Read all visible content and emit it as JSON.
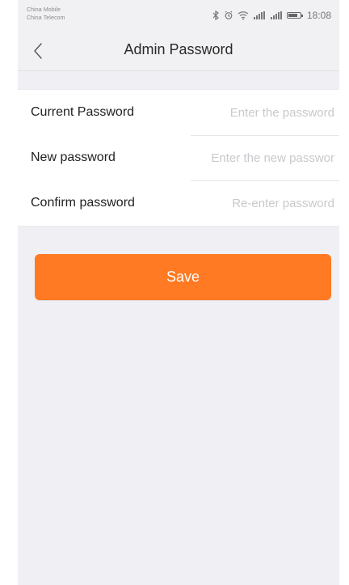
{
  "status_bar": {
    "carrier_1": "China Mobile",
    "carrier_2": "China Telecom",
    "time": "18:08",
    "icons": [
      "bluetooth-icon",
      "alarm-icon",
      "wifi-icon",
      "signal-icon",
      "signal-icon",
      "battery-icon"
    ],
    "battery_level": 0.75
  },
  "header": {
    "title": "Admin Password",
    "back_icon": "chevron-left-icon"
  },
  "form": {
    "rows": [
      {
        "label": "Current Password",
        "placeholder": "Enter the password",
        "value": ""
      },
      {
        "label": "New password",
        "placeholder": "Enter the new passwor",
        "value": ""
      },
      {
        "label": "Confirm password",
        "placeholder": "Re-enter password",
        "value": ""
      }
    ]
  },
  "actions": {
    "save_label": "Save"
  },
  "colors": {
    "accent": "#ff7a22",
    "background": "#efeff4",
    "bar_background": "#f1f1f3",
    "placeholder": "#c9c9cd"
  }
}
